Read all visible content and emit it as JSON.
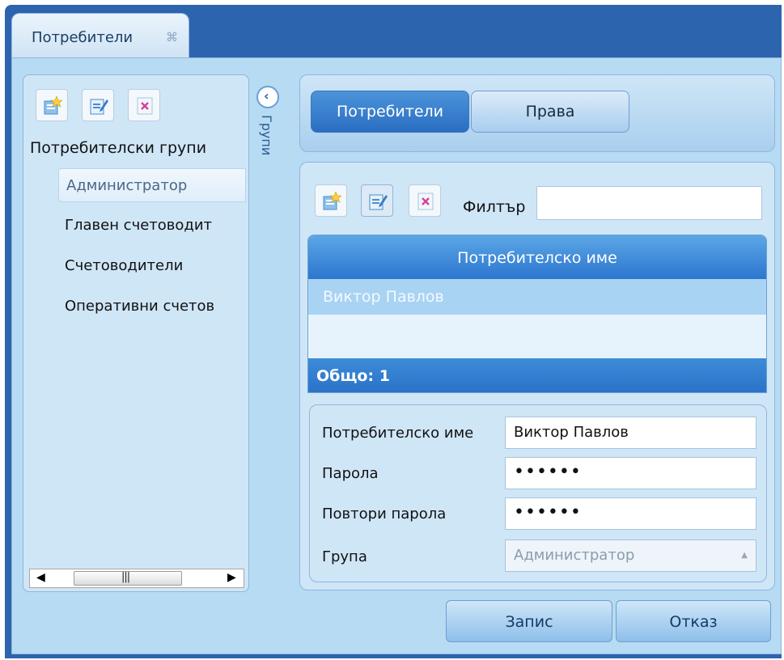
{
  "window": {
    "tab_title": "Потребители",
    "tab_close_glyph": "⌘"
  },
  "left_panel": {
    "toolbar": [
      {
        "icon": "add-star-icon"
      },
      {
        "icon": "edit-icon"
      },
      {
        "icon": "delete-icon"
      }
    ],
    "title": "Потребителски групи",
    "items": [
      {
        "label": "Администратор",
        "selected": true
      },
      {
        "label": "Главен счетоводит",
        "selected": false
      },
      {
        "label": "Счетоводители",
        "selected": false
      },
      {
        "label": "Оперативни счетов",
        "selected": false
      }
    ],
    "collapse_label": "Групи",
    "collapse_icon": "chevron-left-icon"
  },
  "right_panel": {
    "tabs": [
      {
        "label": "Потребители",
        "active": true
      },
      {
        "label": "Права",
        "active": false
      }
    ],
    "filter_label": "Филтър",
    "filter_value": "",
    "grid": {
      "column_header": "Потребителско име",
      "rows": [
        "Виктор Павлов"
      ],
      "footer": "Общо: 1"
    },
    "form": {
      "username_label": "Потребителско име",
      "username_value": "Виктор Павлов",
      "password_label": "Парола",
      "password_value": "••••••",
      "repeat_password_label": "Повтори парола",
      "repeat_password_value": "••••••",
      "group_label": "Група",
      "group_value": "Администратор"
    }
  },
  "buttons": {
    "save": "Запис",
    "cancel": "Отказ"
  },
  "colors": {
    "frame_blue": "#2d64ae",
    "panel_bg": "#b7dbf3",
    "accent": "#2c76cf"
  }
}
